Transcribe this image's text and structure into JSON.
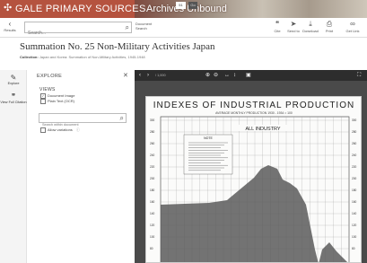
{
  "header": {
    "brand": "GALE PRIMARY SOURCES",
    "archive": "Archives Unbound"
  },
  "toolbar": {
    "results_label": "Results",
    "search_placeholder": "Search...",
    "doc_search_label": "Document Search",
    "tools": [
      {
        "icon": "cite-icon",
        "label": "Cite"
      },
      {
        "icon": "send-icon",
        "label": "Send to"
      },
      {
        "icon": "download-icon",
        "label": "Download"
      },
      {
        "icon": "print-icon",
        "label": "Print"
      },
      {
        "icon": "get-link-icon",
        "label": "Get Link"
      }
    ]
  },
  "document": {
    "title": "Summation No. 25 Non-Military Activities Japan",
    "collection_label": "Collection:",
    "collection_value": "Japan and Korea: Summation of Non-Military Activities, 1945-1948"
  },
  "rail": {
    "items": [
      {
        "icon": "explore-icon",
        "label": "Explore"
      },
      {
        "icon": "full-citation-icon",
        "label": "View Full Citation"
      }
    ]
  },
  "explore": {
    "title": "EXPLORE",
    "views_label": "VIEWS",
    "views": [
      {
        "label": "Document Image",
        "checked": true
      },
      {
        "label": "Plain Text (OCR)",
        "checked": false
      }
    ],
    "search_placeholder": "Search within document",
    "variations_label": "Allow variations"
  },
  "viewer": {
    "page_of": "/ 1,000",
    "page_value": "51",
    "go_label": "Go"
  },
  "scan": {
    "title": "INDEXES OF INDUSTRIAL PRODUCTION",
    "subtitle": "AVERAGE MONTHLY PRODUCTION   1930 - 1934 = 100",
    "inner_label": "ALL INDUSTRY",
    "note_label": "NOTE",
    "y_ticks": [
      "300",
      "280",
      "260",
      "240",
      "220",
      "200",
      "180",
      "160",
      "140",
      "120",
      "100",
      "80"
    ]
  }
}
